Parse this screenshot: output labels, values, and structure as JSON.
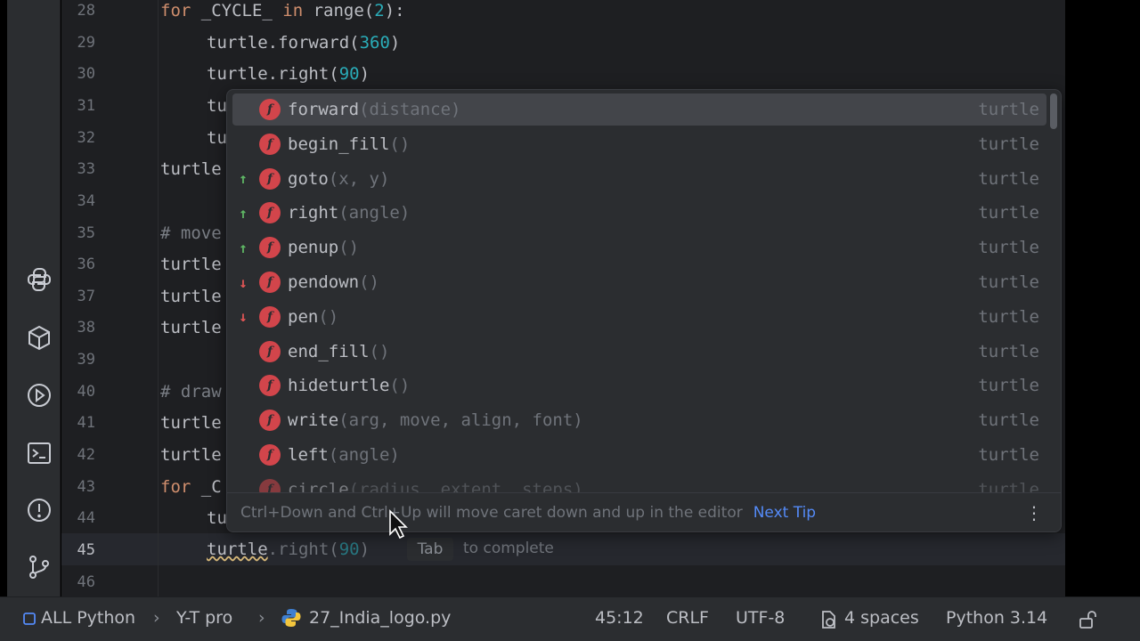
{
  "editor": {
    "lines": [
      {
        "num": "28"
      },
      {
        "num": "29"
      },
      {
        "num": "30"
      },
      {
        "num": "31"
      },
      {
        "num": "32"
      },
      {
        "num": "33"
      },
      {
        "num": "34"
      },
      {
        "num": "35"
      },
      {
        "num": "36"
      },
      {
        "num": "37"
      },
      {
        "num": "38"
      },
      {
        "num": "39"
      },
      {
        "num": "40"
      },
      {
        "num": "41"
      },
      {
        "num": "42"
      },
      {
        "num": "43"
      },
      {
        "num": "44"
      },
      {
        "num": "45"
      },
      {
        "num": "46"
      }
    ],
    "code": {
      "l28_kw1": "for",
      "l28_var": " _CYCLE_ ",
      "l28_kw2": "in",
      "l28_range": " range(",
      "l28_num": "2",
      "l28_end": "):",
      "l29_a": "turtle.forward(",
      "l29_num": "360",
      "l29_b": ")",
      "l30_a": "turtle.right(",
      "l30_num": "90",
      "l30_b": ")",
      "l31": "tu",
      "l32": "tu",
      "l33": "turtle",
      "l35": "# move",
      "l36": "turtle",
      "l37": "turtle",
      "l38": "turtle",
      "l40": "# draw",
      "l41": "turtle",
      "l42": "turtle",
      "l43_kw": "for",
      "l43_rest": " _C",
      "l44": "tu",
      "l45_a": "turtle",
      "l45_b": ".right(",
      "l45_num": "90",
      "l45_c": ")"
    },
    "inline_hint": {
      "key": "Tab",
      "text": "to complete"
    }
  },
  "completion": {
    "items": [
      {
        "arrow": "",
        "name": "forward",
        "params": "(distance)",
        "type": "turtle"
      },
      {
        "arrow": "",
        "name": "begin_fill",
        "params": "()",
        "type": "turtle"
      },
      {
        "arrow": "up",
        "name": "goto",
        "params": "(x, y)",
        "type": "turtle"
      },
      {
        "arrow": "up",
        "name": "right",
        "params": "(angle)",
        "type": "turtle"
      },
      {
        "arrow": "up",
        "name": "penup",
        "params": "()",
        "type": "turtle"
      },
      {
        "arrow": "down",
        "name": "pendown",
        "params": "()",
        "type": "turtle"
      },
      {
        "arrow": "down",
        "name": "pen",
        "params": "()",
        "type": "turtle"
      },
      {
        "arrow": "",
        "name": "end_fill",
        "params": "()",
        "type": "turtle"
      },
      {
        "arrow": "",
        "name": "hideturtle",
        "params": "()",
        "type": "turtle"
      },
      {
        "arrow": "",
        "name": "write",
        "params": "(arg, move, align, font)",
        "type": "turtle"
      },
      {
        "arrow": "",
        "name": "left",
        "params": "(angle)",
        "type": "turtle"
      },
      {
        "arrow": "",
        "name": "circle",
        "params": "(radius, extent, steps)",
        "type": "turtle"
      }
    ],
    "tip": "Ctrl+Down and Ctrl+Up will move caret down and up in the editor",
    "tip_link": "Next Tip",
    "selected_index": 0
  },
  "statusbar": {
    "project": "ALL Python",
    "folder": "Y-T pro",
    "file": "27_India_logo.py",
    "position": "45:12",
    "line_ending": "CRLF",
    "encoding": "UTF-8",
    "indent": "4 spaces",
    "interpreter": "Python 3.14"
  },
  "colors": {
    "editor_bg": "#1e1f22",
    "panel_bg": "#2b2d30",
    "keyword": "#cf8e6d",
    "number": "#2aacb8",
    "link": "#548af7",
    "function_badge": "#d2454b"
  }
}
